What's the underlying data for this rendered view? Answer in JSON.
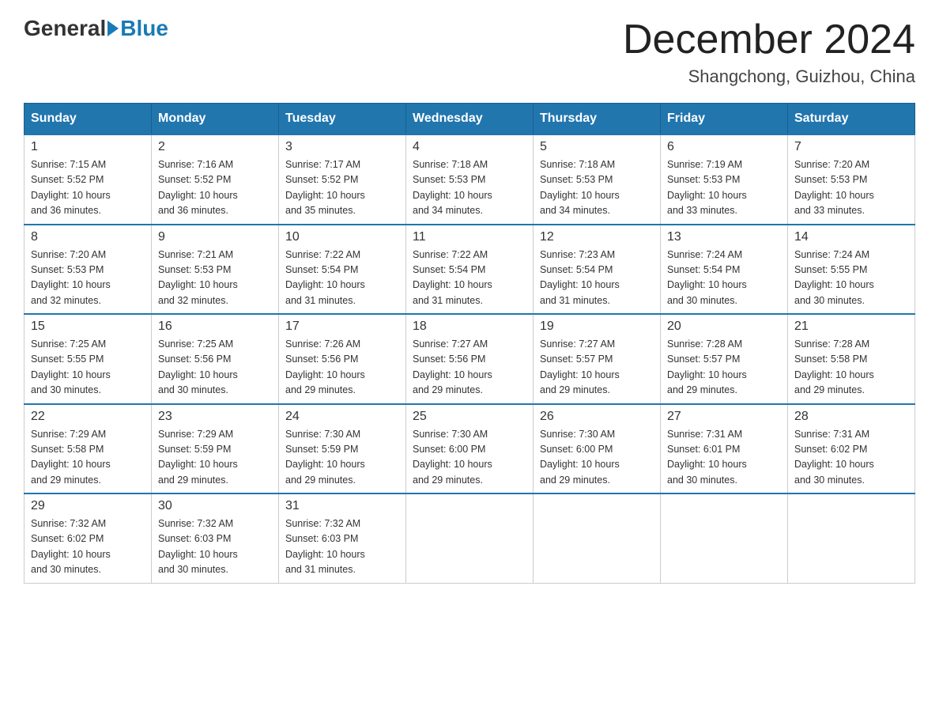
{
  "header": {
    "logo": {
      "general": "General",
      "blue": "Blue"
    },
    "title": "December 2024",
    "subtitle": "Shangchong, Guizhou, China"
  },
  "calendar": {
    "headers": [
      "Sunday",
      "Monday",
      "Tuesday",
      "Wednesday",
      "Thursday",
      "Friday",
      "Saturday"
    ],
    "weeks": [
      [
        {
          "day": "1",
          "sunrise": "7:15 AM",
          "sunset": "5:52 PM",
          "daylight": "10 hours and 36 minutes."
        },
        {
          "day": "2",
          "sunrise": "7:16 AM",
          "sunset": "5:52 PM",
          "daylight": "10 hours and 36 minutes."
        },
        {
          "day": "3",
          "sunrise": "7:17 AM",
          "sunset": "5:52 PM",
          "daylight": "10 hours and 35 minutes."
        },
        {
          "day": "4",
          "sunrise": "7:18 AM",
          "sunset": "5:53 PM",
          "daylight": "10 hours and 34 minutes."
        },
        {
          "day": "5",
          "sunrise": "7:18 AM",
          "sunset": "5:53 PM",
          "daylight": "10 hours and 34 minutes."
        },
        {
          "day": "6",
          "sunrise": "7:19 AM",
          "sunset": "5:53 PM",
          "daylight": "10 hours and 33 minutes."
        },
        {
          "day": "7",
          "sunrise": "7:20 AM",
          "sunset": "5:53 PM",
          "daylight": "10 hours and 33 minutes."
        }
      ],
      [
        {
          "day": "8",
          "sunrise": "7:20 AM",
          "sunset": "5:53 PM",
          "daylight": "10 hours and 32 minutes."
        },
        {
          "day": "9",
          "sunrise": "7:21 AM",
          "sunset": "5:53 PM",
          "daylight": "10 hours and 32 minutes."
        },
        {
          "day": "10",
          "sunrise": "7:22 AM",
          "sunset": "5:54 PM",
          "daylight": "10 hours and 31 minutes."
        },
        {
          "day": "11",
          "sunrise": "7:22 AM",
          "sunset": "5:54 PM",
          "daylight": "10 hours and 31 minutes."
        },
        {
          "day": "12",
          "sunrise": "7:23 AM",
          "sunset": "5:54 PM",
          "daylight": "10 hours and 31 minutes."
        },
        {
          "day": "13",
          "sunrise": "7:24 AM",
          "sunset": "5:54 PM",
          "daylight": "10 hours and 30 minutes."
        },
        {
          "day": "14",
          "sunrise": "7:24 AM",
          "sunset": "5:55 PM",
          "daylight": "10 hours and 30 minutes."
        }
      ],
      [
        {
          "day": "15",
          "sunrise": "7:25 AM",
          "sunset": "5:55 PM",
          "daylight": "10 hours and 30 minutes."
        },
        {
          "day": "16",
          "sunrise": "7:25 AM",
          "sunset": "5:56 PM",
          "daylight": "10 hours and 30 minutes."
        },
        {
          "day": "17",
          "sunrise": "7:26 AM",
          "sunset": "5:56 PM",
          "daylight": "10 hours and 29 minutes."
        },
        {
          "day": "18",
          "sunrise": "7:27 AM",
          "sunset": "5:56 PM",
          "daylight": "10 hours and 29 minutes."
        },
        {
          "day": "19",
          "sunrise": "7:27 AM",
          "sunset": "5:57 PM",
          "daylight": "10 hours and 29 minutes."
        },
        {
          "day": "20",
          "sunrise": "7:28 AM",
          "sunset": "5:57 PM",
          "daylight": "10 hours and 29 minutes."
        },
        {
          "day": "21",
          "sunrise": "7:28 AM",
          "sunset": "5:58 PM",
          "daylight": "10 hours and 29 minutes."
        }
      ],
      [
        {
          "day": "22",
          "sunrise": "7:29 AM",
          "sunset": "5:58 PM",
          "daylight": "10 hours and 29 minutes."
        },
        {
          "day": "23",
          "sunrise": "7:29 AM",
          "sunset": "5:59 PM",
          "daylight": "10 hours and 29 minutes."
        },
        {
          "day": "24",
          "sunrise": "7:30 AM",
          "sunset": "5:59 PM",
          "daylight": "10 hours and 29 minutes."
        },
        {
          "day": "25",
          "sunrise": "7:30 AM",
          "sunset": "6:00 PM",
          "daylight": "10 hours and 29 minutes."
        },
        {
          "day": "26",
          "sunrise": "7:30 AM",
          "sunset": "6:00 PM",
          "daylight": "10 hours and 29 minutes."
        },
        {
          "day": "27",
          "sunrise": "7:31 AM",
          "sunset": "6:01 PM",
          "daylight": "10 hours and 30 minutes."
        },
        {
          "day": "28",
          "sunrise": "7:31 AM",
          "sunset": "6:02 PM",
          "daylight": "10 hours and 30 minutes."
        }
      ],
      [
        {
          "day": "29",
          "sunrise": "7:32 AM",
          "sunset": "6:02 PM",
          "daylight": "10 hours and 30 minutes."
        },
        {
          "day": "30",
          "sunrise": "7:32 AM",
          "sunset": "6:03 PM",
          "daylight": "10 hours and 30 minutes."
        },
        {
          "day": "31",
          "sunrise": "7:32 AM",
          "sunset": "6:03 PM",
          "daylight": "10 hours and 31 minutes."
        },
        null,
        null,
        null,
        null
      ]
    ]
  }
}
